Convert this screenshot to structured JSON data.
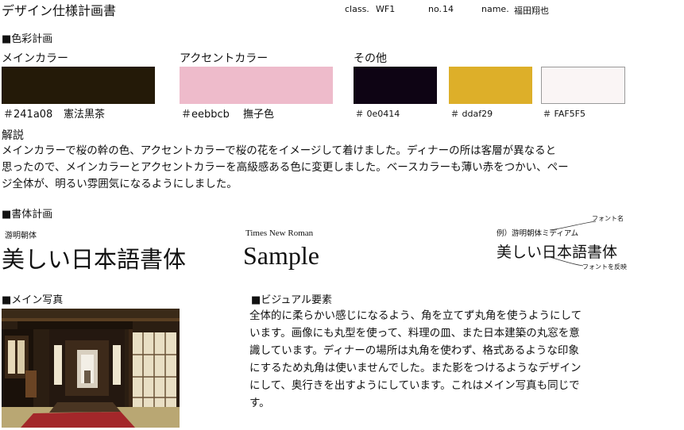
{
  "header": {
    "title": "デザイン仕様計画書",
    "class_label": "class.",
    "class_value": "WF1",
    "no_label": "no.",
    "no_value": "14",
    "name_label": "name.",
    "name_value": "福田翔也"
  },
  "color_plan": {
    "heading": "■色彩計画",
    "main_label": "メインカラー",
    "accent_label": "アクセントカラー",
    "other_label": "その他",
    "swatches": [
      {
        "hex": "#241a08",
        "caption": "＃241a08",
        "name": "憲法黒茶"
      },
      {
        "hex": "#eebbcb",
        "caption": "＃eebbcb",
        "name": "撫子色"
      },
      {
        "hex": "#0e0414",
        "caption": "＃ 0e0414",
        "name": ""
      },
      {
        "hex": "#ddaf29",
        "caption": "＃ ddaf29",
        "name": ""
      },
      {
        "hex": "#FAF5F5",
        "caption": "＃ FAF5F5",
        "name": ""
      }
    ],
    "explanation_heading": "解説",
    "explanation_lines": [
      "メインカラーで桜の幹の色、アクセントカラーで桜の花をイメージして着けました。ディナーの所は客層が異なると",
      "思ったので、メインカラーとアクセントカラーを高級感ある色に変更しました。ベースカラーも薄い赤をつかい、ペー",
      "ジ全体が、明るい雰囲気になるようにしました。"
    ]
  },
  "typeface_plan": {
    "heading": "■書体計画",
    "jp_font_name": "游明朝体",
    "jp_sample": "美しい日本語書体",
    "en_font_name": "Times New Roman",
    "en_sample": "Sample",
    "example_caption": "例）游明朝体ミディアム",
    "example_sample": "美しい日本語書体",
    "note_font_name": "フォント名",
    "note_font_applied": "フォントを反映"
  },
  "main_photo": {
    "heading": "■メイン写真"
  },
  "visual": {
    "heading": "■ビジュアル要素",
    "lines": [
      "全体的に柔らかい感じになるよう、角を立てず丸角を使うようにして",
      "います。画像にも丸型を使って、料理の皿、また日本建築の丸窓を意",
      "識しています。ディナーの場所は丸角を使わず、格式あるような印象",
      "にするため丸角は使いませんでした。また影をつけるようなデザイン",
      "にして、奥行きを出すようにしています。これはメイン写真も同じで",
      "す。"
    ]
  },
  "colors": {
    "text": "#111111",
    "line": "#333333"
  }
}
